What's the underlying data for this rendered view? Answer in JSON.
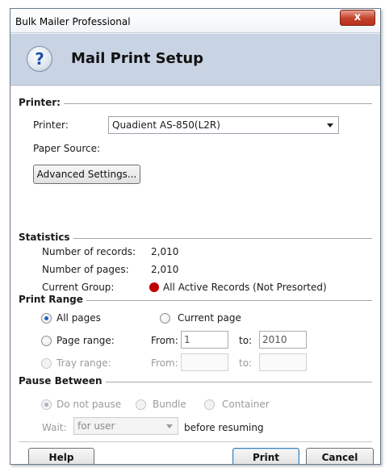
{
  "window": {
    "title": "Bulk Mailer Professional",
    "close_glyph": "x"
  },
  "banner": {
    "icon": "help-icon",
    "icon_glyph": "?",
    "title": "Mail Print Setup"
  },
  "printer_section": {
    "heading": "Printer:",
    "printer_label": "Printer:",
    "printer_value": "Quadient AS-850(L2R)",
    "paper_source_label": "Paper Source:",
    "advanced_button": "Advanced Settings..."
  },
  "statistics": {
    "heading": "Statistics",
    "records_label": "Number of records:",
    "records_value": "2,010",
    "pages_label": "Number of pages:",
    "pages_value": "2,010",
    "group_label": "Current Group:",
    "group_value": "All Active Records (Not Presorted)",
    "group_dot_color": "#c00000"
  },
  "print_range": {
    "heading": "Print Range",
    "all_pages": "All pages",
    "current_page": "Current page",
    "page_range": "Page range:",
    "page_from_label": "From:",
    "page_from_value": "1",
    "page_to_label": "to:",
    "page_to_value": "2010",
    "tray_range": "Tray range:",
    "tray_from_label": "From:",
    "tray_to_label": "to:",
    "selected": "All pages"
  },
  "pause_between": {
    "heading": "Pause Between",
    "do_not_pause": "Do not pause",
    "bundle": "Bundle",
    "container": "Container",
    "wait_label": "Wait:",
    "wait_value": "for user",
    "before_resuming": "before resuming",
    "selected": "Do not pause"
  },
  "footer": {
    "help": "Help",
    "print": "Print",
    "cancel": "Cancel"
  }
}
